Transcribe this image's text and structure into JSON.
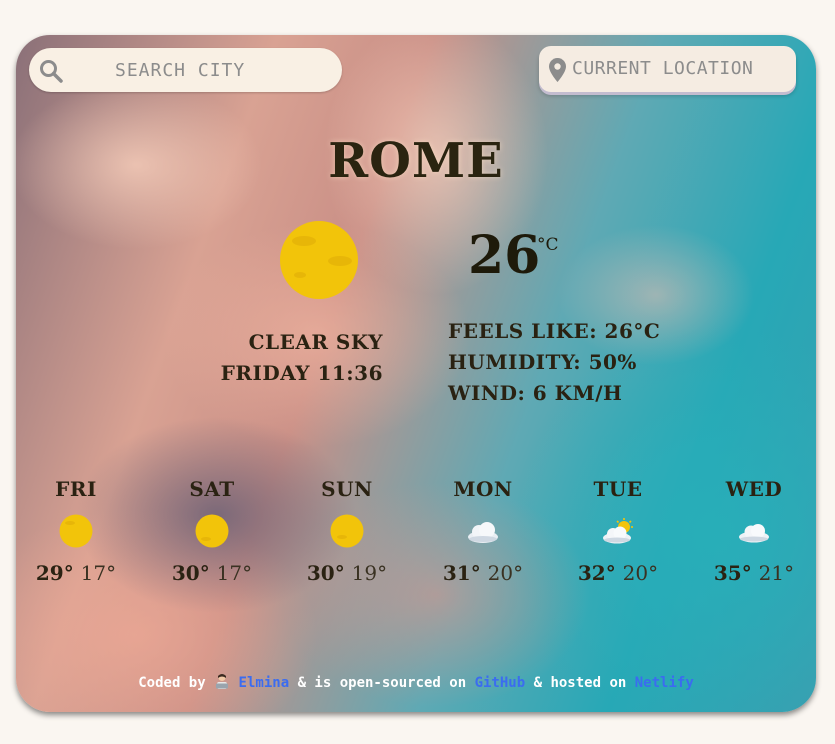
{
  "search": {
    "placeholder": "SEARCH CITY"
  },
  "location_button": {
    "label": "CURRENT LOCATION"
  },
  "weather": {
    "city": "ROME",
    "temperature": "26",
    "unit": "°C",
    "description": "CLEAR SKY",
    "datetime": "FRIDAY 11:36",
    "feels_like": "FEELS LIKE: 26°C",
    "humidity": "HUMIDITY: 50%",
    "wind": "WIND: 6 KM/H",
    "icon": "sun-icon"
  },
  "forecast": [
    {
      "day": "FRI",
      "max": "29°",
      "min": "17°",
      "icon": "sun-icon"
    },
    {
      "day": "SAT",
      "max": "30°",
      "min": "17°",
      "icon": "sun-icon"
    },
    {
      "day": "SUN",
      "max": "30°",
      "min": "19°",
      "icon": "sun-icon"
    },
    {
      "day": "MON",
      "max": "31°",
      "min": "20°",
      "icon": "cloud-icon"
    },
    {
      "day": "TUE",
      "max": "32°",
      "min": "20°",
      "icon": "sun-behind-cloud-icon"
    },
    {
      "day": "WED",
      "max": "35°",
      "min": "21°",
      "icon": "cloud-icon"
    }
  ],
  "footer": {
    "prefix": "Coded by",
    "author": "Elmina",
    "middle": "& is open-sourced on",
    "repo": "GitHub",
    "suffix": "& hosted on",
    "host": "Netlify"
  },
  "colors": {
    "sun": "#f2c40a",
    "link": "#3b6cf0",
    "search_bg": "#f9f0e4",
    "text_dark": "#2a2212"
  }
}
